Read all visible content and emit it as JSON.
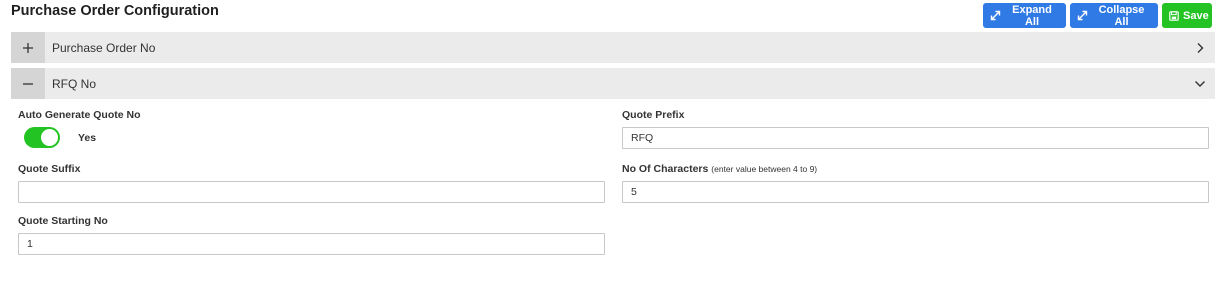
{
  "page": {
    "title": "Purchase Order Configuration"
  },
  "toolbar": {
    "expand_all": "Expand All",
    "collapse_all": "Collapse All",
    "save": "Save"
  },
  "accordion": [
    {
      "label": "Purchase Order No",
      "toggle": "+",
      "state": "collapsed"
    },
    {
      "label": "RFQ No",
      "toggle": "−",
      "state": "expanded"
    }
  ],
  "rfq": {
    "auto_generate": {
      "label": "Auto Generate Quote No",
      "value_label": "Yes",
      "checked": true
    },
    "quote_prefix": {
      "label": "Quote Prefix",
      "value": "RFQ"
    },
    "quote_suffix": {
      "label": "Quote Suffix",
      "value": ""
    },
    "no_of_characters": {
      "label": "No Of Characters",
      "hint": "(enter value between 4 to 9)",
      "value": "5"
    },
    "quote_starting_no": {
      "label": "Quote Starting No",
      "value": "1"
    }
  },
  "colors": {
    "primary": "#2f7ae5",
    "success": "#22c322",
    "panel": "#ebebeb"
  }
}
